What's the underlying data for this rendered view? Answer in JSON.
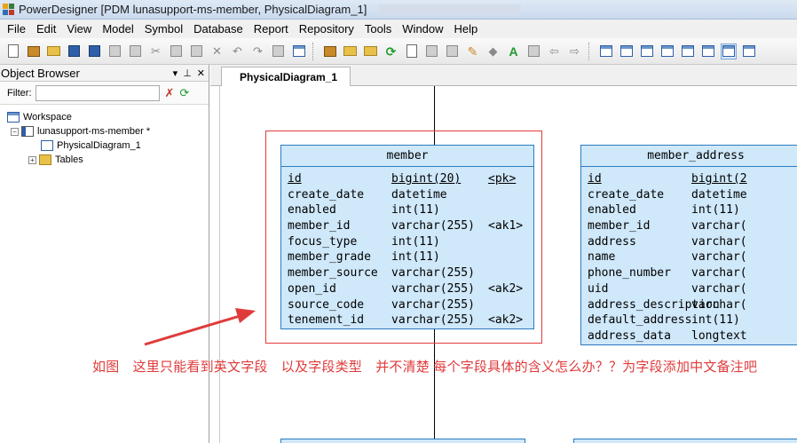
{
  "window": {
    "title": "PowerDesigner [PDM lunasupport-ms-member, PhysicalDiagram_1]"
  },
  "menu": [
    "File",
    "Edit",
    "View",
    "Model",
    "Symbol",
    "Database",
    "Report",
    "Repository",
    "Tools",
    "Window",
    "Help"
  ],
  "object_browser": {
    "title": "Object Browser",
    "filter_label": "Filter:",
    "filter_value": "",
    "tree": {
      "workspace": "Workspace",
      "model": "lunasupport-ms-member *",
      "diagram": "PhysicalDiagram_1",
      "tables": "Tables"
    }
  },
  "diagram_tab": {
    "label": "PhysicalDiagram_1"
  },
  "entities": {
    "member": {
      "name": "member",
      "rows": [
        {
          "name": "id",
          "type": "bigint(20)",
          "key": "<pk>"
        },
        {
          "name": "create_date",
          "type": "datetime",
          "key": ""
        },
        {
          "name": "enabled",
          "type": "int(11)",
          "key": ""
        },
        {
          "name": "member_id",
          "type": "varchar(255)",
          "key": "<ak1>"
        },
        {
          "name": "focus_type",
          "type": "int(11)",
          "key": ""
        },
        {
          "name": "member_grade",
          "type": "int(11)",
          "key": ""
        },
        {
          "name": "member_source",
          "type": "varchar(255)",
          "key": ""
        },
        {
          "name": "open_id",
          "type": "varchar(255)",
          "key": "<ak2>"
        },
        {
          "name": "source_code",
          "type": "varchar(255)",
          "key": ""
        },
        {
          "name": "tenement_id",
          "type": "varchar(255)",
          "key": "<ak2>"
        }
      ]
    },
    "member_address": {
      "name": "member_address",
      "rows": [
        {
          "name": "id",
          "type": "bigint(2"
        },
        {
          "name": "create_date",
          "type": "datetime"
        },
        {
          "name": "enabled",
          "type": "int(11)"
        },
        {
          "name": "member_id",
          "type": "varchar("
        },
        {
          "name": "address",
          "type": "varchar("
        },
        {
          "name": "name",
          "type": "varchar("
        },
        {
          "name": "phone_number",
          "type": "varchar("
        },
        {
          "name": "uid",
          "type": "varchar("
        },
        {
          "name": "address_description",
          "type": "varchar("
        },
        {
          "name": "default_address",
          "type": "int(11)"
        },
        {
          "name": "address_data",
          "type": "longtext"
        }
      ]
    }
  },
  "annotation": "如图　这里只能看到英文字段　以及字段类型　并不清楚 每个字段具体的含义怎么办？？为字段添加中文备注吧",
  "colors": {
    "entity_fill": "#cfe8fa",
    "entity_border": "#2b7bbf",
    "annotation_red": "#e03b3b"
  }
}
